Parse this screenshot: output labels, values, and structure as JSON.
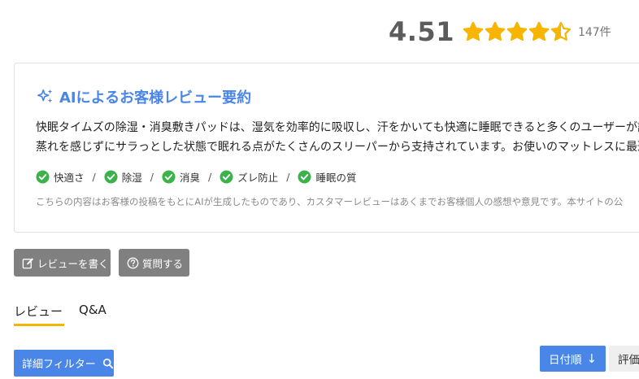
{
  "rating": {
    "score": "4.51",
    "stars_value": 4.51,
    "stars_max": 5,
    "count": "147件",
    "star_color": "#f7b500"
  },
  "ai_summary": {
    "title": "AIによるお客様レビュー要約",
    "text_line1": "快眠タイムズの除湿・消臭敷きパッドは、湿気を効率的に吸収し、汗をかいても快適に睡眠できると多くのユーザーが評価",
    "text_line2": "蒸れを感じずにサラっとした状態で眠れる点がたくさんのスリーパーから支持されています。お使いのマットレスに最適化",
    "tags": [
      "快適さ",
      "除湿",
      "消臭",
      "ズレ防止",
      "睡眠の質"
    ],
    "tag_separator": "/",
    "disclaimer": "こちらの内容はお客様の投稿をもとにAIが生成したものであり、カスタマーレビューはあくまでお客様個人の感想や意見です。本サイトの公",
    "accent_color": "#4a86e8",
    "check_color": "#3cb34a"
  },
  "actions": {
    "write_review": "レビューを書く",
    "ask_question": "質問する"
  },
  "tabs": [
    {
      "label": "レビュー",
      "active": true
    },
    {
      "label": "Q&A",
      "active": false
    }
  ],
  "filter": {
    "detail_filter": "詳細フィルター"
  },
  "sort": {
    "date": "日付順",
    "date_arrow": "↓",
    "rating": "評価"
  }
}
